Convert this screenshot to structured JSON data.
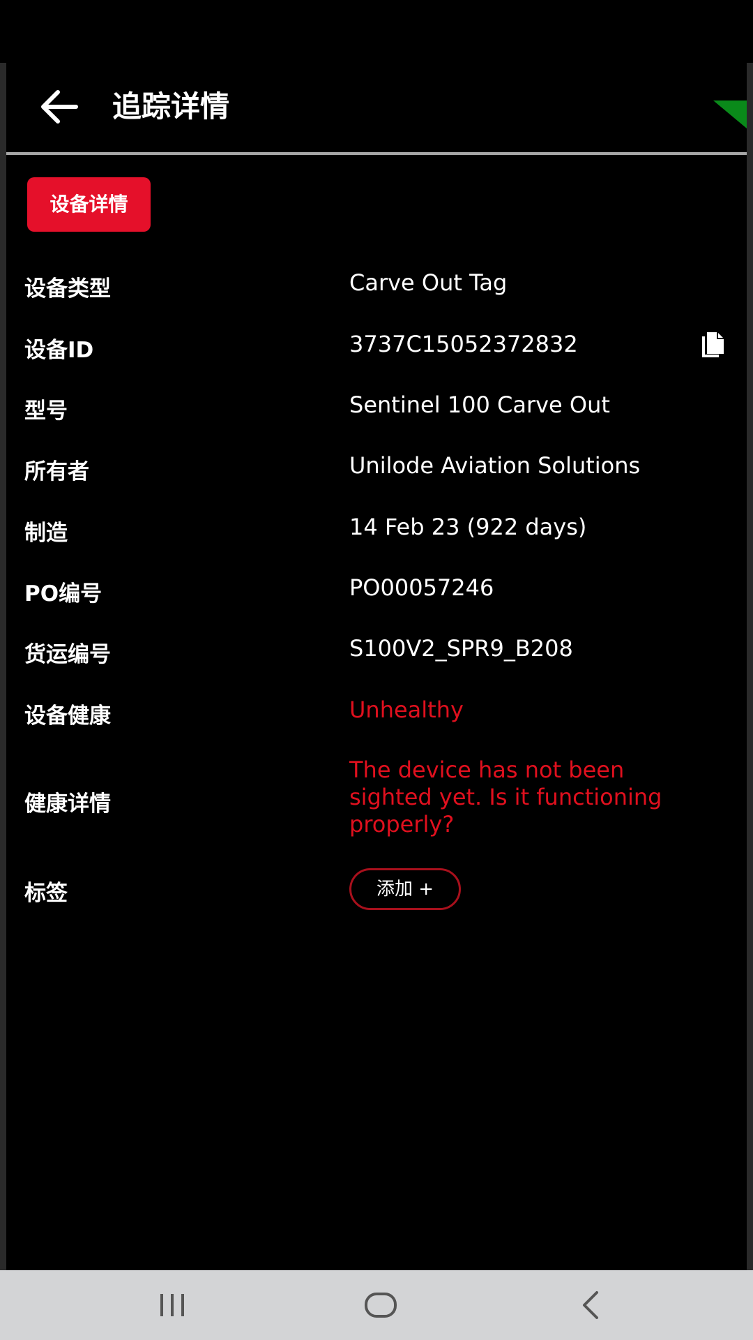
{
  "app_bar": {
    "title": "追踪详情",
    "back_icon": "arrow-left-icon"
  },
  "section_chip": "设备详情",
  "details": {
    "device_type": {
      "label": "设备类型",
      "value": "Carve Out Tag"
    },
    "device_id": {
      "label": "设备ID",
      "value": "3737C15052372832",
      "action_icon": "copy-icon"
    },
    "model": {
      "label": "型号",
      "value": "Sentinel 100 Carve Out"
    },
    "owner": {
      "label": "所有者",
      "value": "Unilode Aviation Solutions"
    },
    "manufactured": {
      "label": "制造",
      "value": "14 Feb 23 (922 days)"
    },
    "po_number": {
      "label": "PO编号",
      "value": "PO00057246"
    },
    "shipment_number": {
      "label": "货运编号",
      "value": "S100V2_SPR9_B208"
    },
    "health": {
      "label": "设备健康",
      "value": "Unhealthy"
    },
    "health_details": {
      "label": "健康详情",
      "value_lines": [
        "The device has not been",
        "sighted yet. Is it functioning",
        "properly?"
      ]
    },
    "tags": {
      "label": "标签",
      "add_label": "添加 +"
    }
  },
  "colors": {
    "accent": "#e5102a",
    "alert_text": "#e0101e",
    "pill_border": "#a8101c",
    "corner_flag": "#0a8a1a",
    "nav_bar_bg": "#d3d4d6"
  },
  "nav": {
    "recents_icon": "recent-apps-icon",
    "home_icon": "home-icon",
    "back_icon": "back-chevron-icon"
  }
}
